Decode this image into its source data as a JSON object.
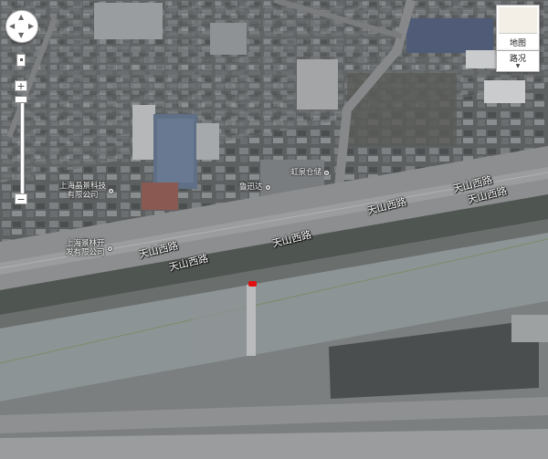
{
  "roads": [
    {
      "id": "r1",
      "label": "天山西路"
    },
    {
      "id": "r2",
      "label": "天山西路"
    },
    {
      "id": "r3",
      "label": "天山西路"
    },
    {
      "id": "r4",
      "label": "天山西路"
    },
    {
      "id": "r5",
      "label": "天山西路"
    },
    {
      "id": "r6",
      "label": "天山西路"
    }
  ],
  "pois": [
    {
      "id": "p1",
      "label": "上海晶景科技\n有限公司"
    },
    {
      "id": "p2",
      "label": "上海景林开\n发有限公司"
    },
    {
      "id": "p3",
      "label": "鲁迅达"
    },
    {
      "id": "p4",
      "label": "虹泉仓储"
    }
  ],
  "controls": {
    "pan_arrows": {
      "up": "▲",
      "down": "▼",
      "left": "◀",
      "right": "▶"
    },
    "zoom_in": "+",
    "zoom_out": "−",
    "map_type_label": "地图",
    "traffic_label": "路况",
    "traffic_arrow": "▼"
  },
  "marker_color": "#e01010"
}
